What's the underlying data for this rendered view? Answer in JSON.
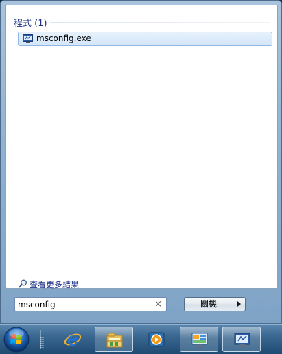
{
  "results": {
    "group_header": "程式 (1)",
    "items": [
      {
        "label": "msconfig.exe",
        "icon": "system-config-icon"
      }
    ]
  },
  "more_results": {
    "label": "查看更多結果",
    "icon": "search-magnifier-icon"
  },
  "search": {
    "value": "msconfig",
    "clear_glyph": "×"
  },
  "shutdown": {
    "label": "關機",
    "options_icon": "arrow-right-icon"
  },
  "taskbar": {
    "start_icon": "windows-orb-icon",
    "items": [
      {
        "name": "internet-explorer",
        "icon": "internet-explorer-icon"
      },
      {
        "name": "file-explorer",
        "icon": "folder-icon"
      },
      {
        "name": "media-player",
        "icon": "media-player-icon"
      },
      {
        "name": "control-panel",
        "icon": "control-panel-icon"
      },
      {
        "name": "system-config",
        "icon": "system-config-icon"
      }
    ]
  }
}
